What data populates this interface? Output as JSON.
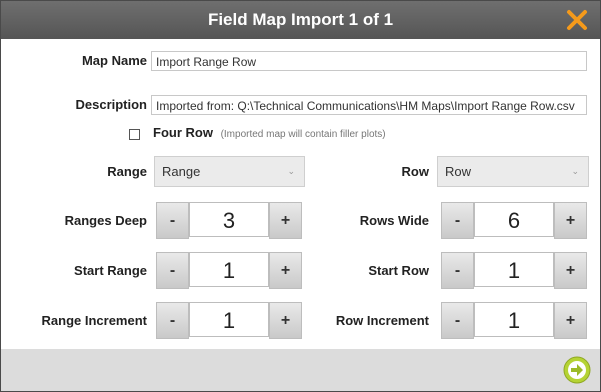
{
  "dialog": {
    "title": "Field Map Import 1 of 1",
    "close_icon": "close-x-icon",
    "accent": "#f59a1b"
  },
  "form": {
    "map_name_label": "Map Name",
    "map_name_value": "Import Range Row",
    "description_label": "Description",
    "description_value": "Imported from: Q:\\Technical Communications\\HM Maps\\Import Range Row.csv",
    "four_row_label": "Four Row",
    "four_row_note": "(Imported map will contain filler plots)",
    "four_row_checked": false,
    "range_label": "Range",
    "range_value": "Range",
    "row_label": "Row",
    "row_value": "Row",
    "ranges_deep_label": "Ranges Deep",
    "ranges_deep_value": "3",
    "rows_wide_label": "Rows Wide",
    "rows_wide_value": "6",
    "start_range_label": "Start Range",
    "start_range_value": "1",
    "start_row_label": "Start Row",
    "start_row_value": "1",
    "range_increment_label": "Range Increment",
    "range_increment_value": "1",
    "row_increment_label": "Row Increment",
    "row_increment_value": "1",
    "decrement_symbol": "-",
    "increment_symbol": "+"
  },
  "footer": {
    "next_icon": "arrow-right-circle-icon",
    "next_color": "#b5d334"
  }
}
